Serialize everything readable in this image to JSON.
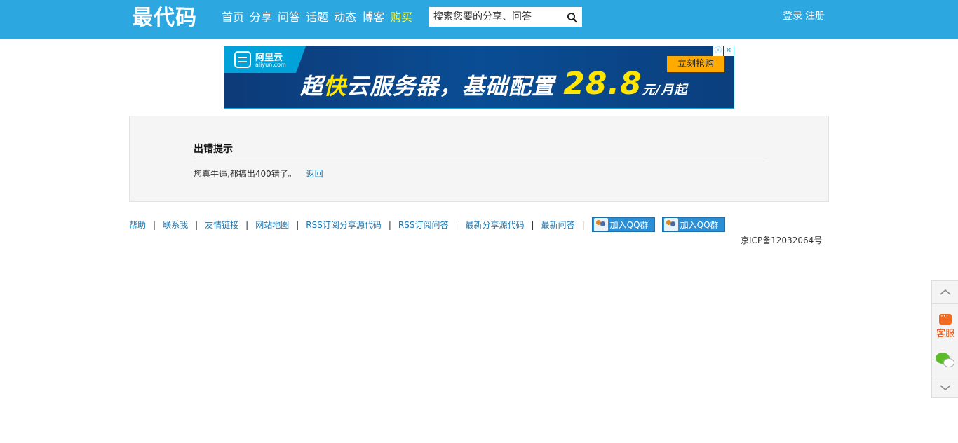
{
  "header": {
    "logo": "最代码",
    "nav": [
      "首页",
      "分享",
      "问答",
      "话题",
      "动态",
      "博客"
    ],
    "nav_buy": "购买",
    "search_placeholder": "搜索您要的分享、问答",
    "login": "登录",
    "register": "注册",
    "accent": "#2ca7e0"
  },
  "ad": {
    "brand": "阿里云",
    "brand_domain": "aliyun.com",
    "headline_pre": "超",
    "headline_hl": "快",
    "headline_post": "云服务器，基础配置",
    "price": "28.8",
    "unit": "元/月起",
    "cta": "立刻抢购"
  },
  "error": {
    "title": "出错提示",
    "message_pre": "您真牛逼,都搞出",
    "code": "400",
    "message_post": "错了。",
    "back": "返回"
  },
  "footer": {
    "links": [
      "帮助",
      "联系我",
      "友情链接",
      "网站地图",
      "RSS订阅分享源代码",
      "RSS订阅问答",
      "最新分享源代码",
      "最新问答"
    ],
    "qq_button": "加入QQ群",
    "icp": "京ICP备12032064号"
  },
  "sidebar": {
    "service": "客服"
  }
}
